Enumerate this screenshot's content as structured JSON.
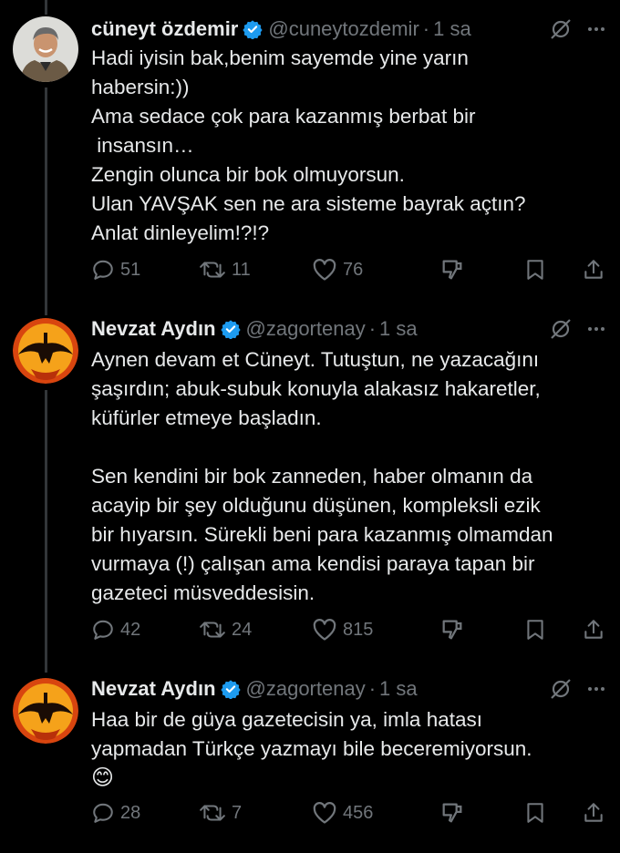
{
  "tweets": [
    {
      "author_name": "cüneyt özdemir",
      "handle": "@cuneytozdemir",
      "time": "1 sa",
      "text": "Hadi iyisin bak,benim sayemde yine yarın\nhabersin:))\nAma sedace çok para kazanmış berbat bir\n insansın…\nZengin olunca bir bok olmuyorsun.\nUlan YAVŞAK sen ne ara sisteme bayrak açtın?\nAnlat dinleyelim!?!?",
      "replies": "51",
      "reposts": "11",
      "likes": "76",
      "avatar": "person-photo"
    },
    {
      "author_name": "Nevzat Aydın",
      "handle": "@zagortenay",
      "time": "1 sa",
      "text": "Aynen devam et Cüneyt. Tutuştun, ne yazacağını\nşaşırdın; abuk-subuk konuyla alakasız hakaretler,\nküfürler etmeye başladın.\n\nSen kendini bir bok zanneden, haber olmanın da\nacayip bir şey olduğunu düşünen, kompleksli ezik\nbir hıyarsın. Sürekli beni para kazanmış olmamdan\nvurmaya (!) çalışan ama kendisi paraya tapan bir\ngazeteci müsveddesisin.",
      "replies": "42",
      "reposts": "24",
      "likes": "815",
      "avatar": "axe-logo"
    },
    {
      "author_name": "Nevzat Aydın",
      "handle": "@zagortenay",
      "time": "1 sa",
      "text": "Haa bir de güya gazetecisin ya, imla hatası\nyapmadan Türkçe yazmayı bile beceremiyorsun.",
      "emoji": "😊",
      "replies": "28",
      "reposts": "7",
      "likes": "456",
      "avatar": "axe-logo"
    }
  ],
  "colors": {
    "background": "#000000",
    "text": "#e7e9ea",
    "muted": "#71767b",
    "verified": "#1d9bf0",
    "thread_line": "#333639"
  }
}
